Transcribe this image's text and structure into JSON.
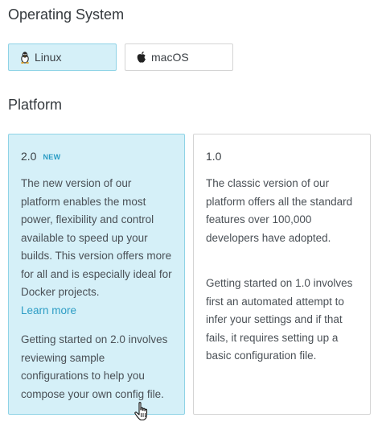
{
  "os_section": {
    "title": "Operating System",
    "options": [
      {
        "label": "Linux",
        "icon": "linux-tux-icon",
        "selected": true
      },
      {
        "label": "macOS",
        "icon": "apple-icon",
        "selected": false
      }
    ]
  },
  "platform_section": {
    "title": "Platform",
    "cards": [
      {
        "version": "2.0",
        "badge": "NEW",
        "selected": true,
        "description": "The new version of our platform enables the most power, flexibility and control available to speed up your builds. This version offers more for all and is especially ideal for Docker projects.",
        "link_label": "Learn more",
        "getting_started": "Getting started on 2.0 involves reviewing sample configurations to help you compose your own config file."
      },
      {
        "version": "1.0",
        "selected": false,
        "description": "The classic version of our platform offers all the standard features over 100,000 developers have adopted.",
        "getting_started": "Getting started on 1.0 involves first an automated attempt to infer your settings and if that fails, it requires setting up a basic configuration file."
      }
    ]
  },
  "colors": {
    "selected_bg": "#d5f0f8",
    "selected_border": "#8fd3e6",
    "accent": "#2b9cc4",
    "border": "#d4d4d4"
  }
}
